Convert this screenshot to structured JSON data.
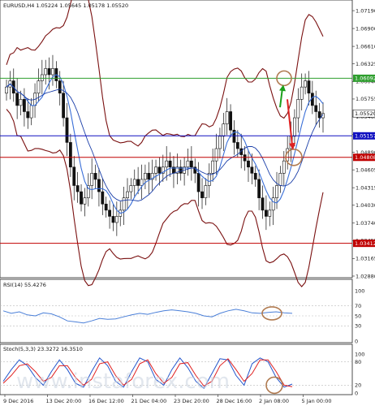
{
  "header": {
    "title": "EURUSD,H4  1.05224 1.05645 1.05178 1.05520",
    "rsi_label": "RSI(14) 55.4276",
    "stoch_label": "Stoch(5,3,3) 23.3272 16.3510"
  },
  "watermark": "www.instaforex.com",
  "colors": {
    "green_level": "#2e9e2e",
    "blue_level": "#1010c0",
    "red_level": "#c00000",
    "bands": "#7a1010",
    "ma": "#3a6fd8",
    "annotation_circle": "#b07a50",
    "arrow_up": "#1aa01a",
    "arrow_down": "#dd2222",
    "rsi_line": "#4a7fd8",
    "stoch_main": "#2255cc",
    "stoch_signal": "#e02020"
  },
  "chart_data": [
    {
      "type": "candlestick",
      "title": "EURUSD,H4",
      "ohlc_last": {
        "open": 1.05224,
        "high": 1.05645,
        "low": 1.05178,
        "close": 1.0552
      },
      "y_ticks": [
        "1.07190",
        "1.06900",
        "1.06610",
        "1.06325",
        "1.06040",
        "1.05755",
        "1.05465",
        "1.05180",
        "1.04890",
        "1.04605",
        "1.04315",
        "1.04030",
        "1.03740",
        "1.03455",
        "1.03165",
        "1.02880"
      ],
      "ylim": [
        1.0288,
        1.0731
      ],
      "x_labels": [
        "9 Dec 2016",
        "13 Dec 20:00",
        "16 Dec 12:00",
        "21 Dec 04:00",
        "23 Dec 20:00",
        "28 Dec 16:00",
        "2 Jan 08:00",
        "5 Jan 00:00"
      ],
      "levels": [
        {
          "value": 1.06092,
          "label": "1.06092",
          "color": "green"
        },
        {
          "value": 1.0552,
          "label": "1.05520",
          "color": "white"
        },
        {
          "value": 1.05157,
          "label": "1.05157",
          "color": "blue"
        },
        {
          "value": 1.04808,
          "label": "1.04808",
          "color": "red"
        },
        {
          "value": 1.03412,
          "label": "1.03412",
          "color": "red"
        }
      ],
      "close_series": [
        1.0595,
        1.0605,
        1.0585,
        1.0565,
        1.0575,
        1.0555,
        1.0545,
        1.0565,
        1.0585,
        1.0605,
        1.0615,
        1.0625,
        1.0615,
        1.0625,
        1.0605,
        1.0585,
        1.0545,
        1.0505,
        1.0465,
        1.0435,
        1.0425,
        1.0405,
        1.0415,
        1.0435,
        1.0455,
        1.0445,
        1.0425,
        1.0405,
        1.0395,
        1.0385,
        1.0375,
        1.0385,
        1.0395,
        1.0415,
        1.0425,
        1.0435,
        1.0445,
        1.0435,
        1.0445,
        1.0455,
        1.0445,
        1.0455,
        1.0465,
        1.0455,
        1.0465,
        1.0475,
        1.0465,
        1.0455,
        1.0465,
        1.0455,
        1.0465,
        1.0475,
        1.0465,
        1.0455,
        1.0425,
        1.0415,
        1.0435,
        1.0455,
        1.0475,
        1.0495,
        1.0515,
        1.0535,
        1.0555,
        1.0525,
        1.0505,
        1.0495,
        1.0485,
        1.0475,
        1.0465,
        1.0455,
        1.0445,
        1.0415,
        1.0395,
        1.0385,
        1.0395,
        1.0415,
        1.0435,
        1.0455,
        1.0475,
        1.0495,
        1.0515,
        1.0545,
        1.0575,
        1.0595,
        1.0605,
        1.0585,
        1.0565,
        1.0555,
        1.0545,
        1.0552
      ],
      "notes": "Price series approximated from candlestick body midpoints"
    },
    {
      "type": "line",
      "title": "RSI(14) 55.4276",
      "y_ticks": [
        "100",
        "70",
        "50",
        "30",
        "0"
      ],
      "ylim": [
        0,
        100
      ],
      "series": [
        {
          "name": "RSI(14)",
          "values": [
            60,
            55,
            58,
            52,
            50,
            56,
            54,
            48,
            40,
            38,
            36,
            40,
            45,
            43,
            44,
            48,
            52,
            55,
            53,
            57,
            60,
            62,
            60,
            58,
            55,
            50,
            48,
            55,
            60,
            63,
            60,
            56,
            55,
            57,
            58,
            56,
            55
          ]
        }
      ]
    },
    {
      "type": "line",
      "title": "Stoch(5,3,3) 23.3272 16.3510",
      "y_ticks": [
        "100",
        "80",
        "20",
        "0"
      ],
      "ylim": [
        0,
        100
      ],
      "series": [
        {
          "name": "Main",
          "values": [
            30,
            60,
            85,
            70,
            40,
            20,
            55,
            85,
            60,
            25,
            15,
            55,
            90,
            70,
            30,
            15,
            55,
            90,
            80,
            35,
            20,
            60,
            90,
            65,
            30,
            12,
            50,
            88,
            85,
            45,
            20,
            75,
            90,
            80,
            40,
            15,
            23
          ]
        },
        {
          "name": "Signal",
          "values": [
            25,
            45,
            70,
            75,
            55,
            30,
            40,
            70,
            70,
            40,
            20,
            35,
            75,
            80,
            45,
            20,
            35,
            75,
            85,
            50,
            25,
            40,
            75,
            78,
            45,
            18,
            30,
            70,
            88,
            60,
            30,
            50,
            85,
            85,
            55,
            20,
            16
          ]
        }
      ]
    }
  ]
}
